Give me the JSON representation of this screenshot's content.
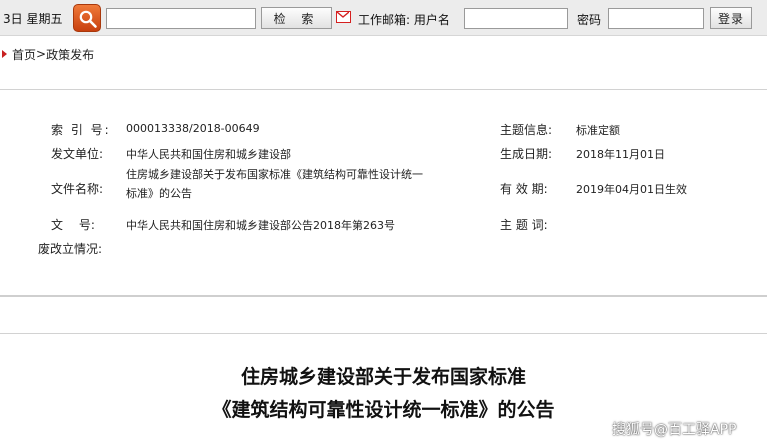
{
  "topbar": {
    "date_text": "3日 星期五",
    "search_placeholder": "",
    "search_button_label": "检 索",
    "mail_label": "工作邮箱: 用户名",
    "username_value": "",
    "password_label": "密码",
    "password_value": "",
    "login_button_label": "登录"
  },
  "breadcrumb": {
    "home": "首页",
    "separator": ">",
    "current": "政策发布"
  },
  "info": {
    "index_label": "索 引 号:",
    "index_value": "000013338/2018-00649",
    "issuer_label": "发文单位:",
    "issuer_value": "中华人民共和国住房和城乡建设部",
    "docname_label": "文件名称:",
    "docname_value": "住房城乡建设部关于发布国家标准《建筑结构可靠性设计统一标准》的公告",
    "docno_label": "文　 号:",
    "docno_value": "中华人民共和国住房和城乡建设部公告2018年第263号",
    "status_label": "废改立情况:",
    "topic_label": "主题信息:",
    "topic_value": "标准定额",
    "created_label": "生成日期:",
    "created_value": "2018年11月01日",
    "validity_label": "有 效 期:",
    "validity_value": "2019年04月01日生效",
    "keywords_label": "主 题 词:"
  },
  "article": {
    "title_line1": "住房城乡建设部关于发布国家标准",
    "title_line2": "《建筑结构可靠性设计统一标准》的公告"
  },
  "watermark": "搜狐号@百工驿APP",
  "colors": {
    "accent_red": "#c82020",
    "search_orange": "#e8622a",
    "topbar_bg": "#ececec"
  }
}
